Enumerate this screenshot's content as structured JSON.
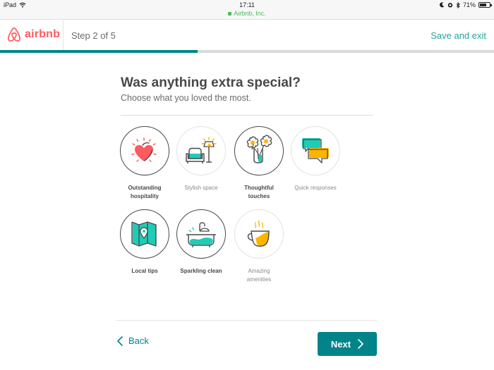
{
  "status_bar": {
    "device": "iPad",
    "time": "17:11",
    "url": "Airbnb, Inc.",
    "battery": "71%",
    "battery_level": 0.71,
    "icons": [
      "wifi-icon",
      "moon-icon",
      "alarm-icon",
      "bluetooth-icon",
      "battery-icon",
      "lock-icon"
    ]
  },
  "header": {
    "brand": "airbnb",
    "step_label": "Step 2 of 5",
    "save_exit_label": "Save and exit",
    "progress_fraction": 0.4
  },
  "colors": {
    "brand": "#ff5a5f",
    "accent": "#008489",
    "link": "#26a39b",
    "teal_icon": "#1ecdb7",
    "yellow_icon": "#ffb400",
    "heart": "#ff5a5f"
  },
  "main": {
    "title": "Was anything extra special?",
    "subtitle": "Choose what you loved the most."
  },
  "options": [
    {
      "label": "Outstanding hospitality",
      "line1": "Outstanding",
      "line2": "hospitality",
      "icon": "heart-icon",
      "selected": true
    },
    {
      "label": "Stylish space",
      "line1": "Stylish space",
      "line2": "",
      "icon": "armchair-lamp-icon",
      "selected": false
    },
    {
      "label": "Thoughtful touches",
      "line1": "Thoughtful",
      "line2": "touches",
      "icon": "flowers-vase-icon",
      "selected": true
    },
    {
      "label": "Quick responses",
      "line1": "Quick responses",
      "line2": "",
      "icon": "chat-bubbles-icon",
      "selected": false
    },
    {
      "label": "Local tips",
      "line1": "Local tips",
      "line2": "",
      "icon": "map-pin-icon",
      "selected": true
    },
    {
      "label": "Sparkling clean",
      "line1": "Sparkling clean",
      "line2": "",
      "icon": "bathtub-icon",
      "selected": true
    },
    {
      "label": "Amazing amenities",
      "line1": "Amazing",
      "line2": "amenities",
      "icon": "coffee-cup-icon",
      "selected": false
    }
  ],
  "footer": {
    "back_label": "Back",
    "next_label": "Next"
  }
}
